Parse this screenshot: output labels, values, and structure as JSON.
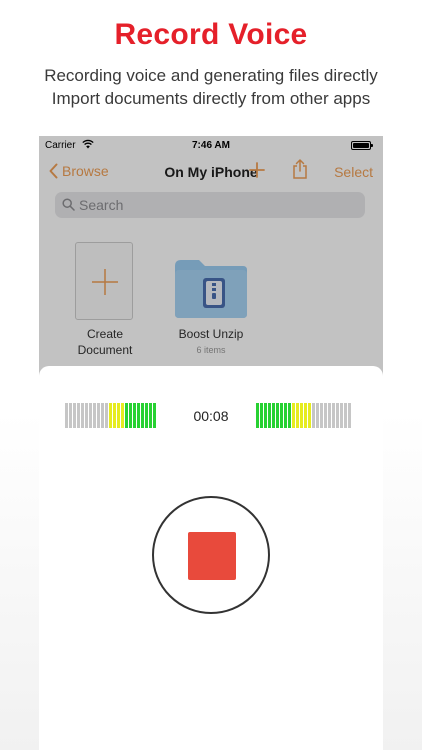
{
  "promo": {
    "headline": "Record Voice",
    "line1": "Recording voice and generating files directly",
    "line2": "Import documents directly from other apps"
  },
  "status_bar": {
    "carrier": "Carrier",
    "time": "7:46 AM",
    "icons": [
      "wifi-icon",
      "battery-icon"
    ]
  },
  "nav": {
    "back_label": "Browse",
    "title": "On My iPhone",
    "select_label": "Select",
    "icons": [
      "chevron-left-icon",
      "plus-icon",
      "share-icon"
    ],
    "accent_color": "#f0a057"
  },
  "search": {
    "placeholder": "Search",
    "value": ""
  },
  "items": [
    {
      "label_line1": "Create",
      "label_line2": "Document",
      "icon": "plus-icon"
    },
    {
      "label": "Boost Unzip",
      "subtitle": "6 items",
      "icon": "zip-folder-icon"
    }
  ],
  "recorder": {
    "timer": "00:08",
    "stop_color": "#e84a3c",
    "left_meter": [
      "gray",
      "gray",
      "gray",
      "gray",
      "gray",
      "gray",
      "gray",
      "gray",
      "gray",
      "gray",
      "gray",
      "yellow",
      "yellow",
      "yellow",
      "yellow",
      "green",
      "green",
      "green",
      "green",
      "green",
      "green",
      "green",
      "green"
    ],
    "right_meter": [
      "green",
      "green",
      "green",
      "green",
      "green",
      "green",
      "green",
      "green",
      "green",
      "yellow",
      "yellow",
      "yellow",
      "yellow",
      "yellow",
      "gray",
      "gray",
      "gray",
      "gray",
      "gray",
      "gray",
      "gray",
      "gray",
      "gray",
      "gray"
    ]
  }
}
